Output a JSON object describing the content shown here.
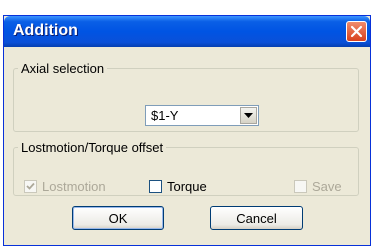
{
  "window": {
    "title": "Addition",
    "close_icon": "close-icon"
  },
  "axial_selection": {
    "legend": "Axial selection",
    "selected": "$1-Y",
    "arrow_icon": "chevron-down-icon"
  },
  "offset": {
    "legend": "Lostmotion/Torque offset",
    "lostmotion_label": "Lostmotion",
    "lostmotion_checked": true,
    "lostmotion_disabled": true,
    "torque_label": "Torque",
    "torque_checked": false,
    "save_label": "Save",
    "save_checked": false,
    "save_disabled": true
  },
  "buttons": {
    "ok": "OK",
    "cancel": "Cancel"
  },
  "colors": {
    "titlebar": "#0054e3",
    "dialog_bg": "#ece9d8",
    "close_button": "#d9411d"
  }
}
